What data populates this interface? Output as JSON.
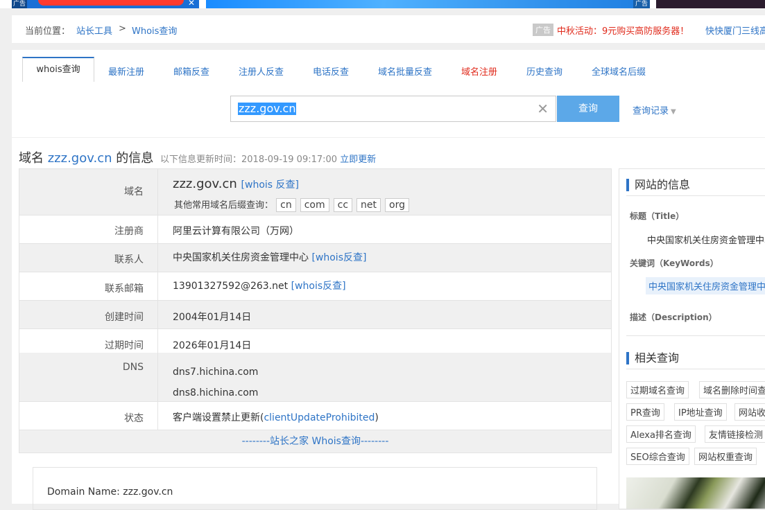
{
  "ads": {
    "tag": "广告"
  },
  "breadcrumb": {
    "label": "当前位置：",
    "items": [
      "站长工具",
      "Whois查询"
    ],
    "separator": ">",
    "ad_tag": "广告",
    "promo": "中秋活动：9元购买高防服务器！",
    "promo2": "快快厦门三线高"
  },
  "tabs": [
    {
      "label": "whois查询"
    },
    {
      "label": "最新注册"
    },
    {
      "label": "邮箱反查"
    },
    {
      "label": "注册人反查"
    },
    {
      "label": "电话反查"
    },
    {
      "label": "域名批量反查"
    },
    {
      "label": "域名注册"
    },
    {
      "label": "历史查询"
    },
    {
      "label": "全球域名后缀"
    }
  ],
  "search": {
    "value": "zzz.gov.cn",
    "button": "查询",
    "history": "查询记录"
  },
  "heading": {
    "prefix": "域名",
    "domain": "zzz.gov.cn",
    "suffix": "的信息",
    "updated": "以下信息更新时间：2018-09-19 09:17:00",
    "refresh": "立即更新"
  },
  "whois": {
    "domain_label": "域名",
    "domain": "zzz.gov.cn",
    "domain_link": "[whois 反查]",
    "suffix_label": "其他常用域名后缀查询：",
    "suffixes": [
      "cn",
      "com",
      "cc",
      "net",
      "org"
    ],
    "registrar_label": "注册商",
    "registrar": "阿里云计算有限公司（万网）",
    "contact_label": "联系人",
    "contact": "中央国家机关住房资金管理中心",
    "contact_link": "[whois反查]",
    "email_label": "联系邮箱",
    "email": "13901327592@263.net",
    "email_link": "[whois反查]",
    "created_label": "创建时间",
    "created": "2004年01月14日",
    "expires_label": "过期时间",
    "expires": "2026年01月14日",
    "dns_label": "DNS",
    "dns": [
      "dns7.hichina.com",
      "dns8.hichina.com"
    ],
    "status_label": "状态",
    "status_text": "客户端设置禁止更新(",
    "status_code": "clientUpdateProhibited",
    "status_close": ")",
    "footer": "--------站长之家 Whois查询--------",
    "raw_first_line": "Domain Name: zzz.gov.cn"
  },
  "sidebar": {
    "site_info_title": "网站的信息",
    "title_label": "标题（Title）",
    "title_value": "中央国家机关住房资金管理中心",
    "keywords_label": "关键词（KeyWords）",
    "keywords_value": "中央国家机关住房资金管理中",
    "desc_label": "描述（Description）",
    "related_title": "相关查询",
    "related": [
      "过期域名查询",
      "域名删除时间查",
      "PR查询",
      "IP地址查询",
      "网站收",
      "Alexa排名查询",
      "友情链接检测",
      "SEO综合查询",
      "网站权重查询"
    ]
  }
}
